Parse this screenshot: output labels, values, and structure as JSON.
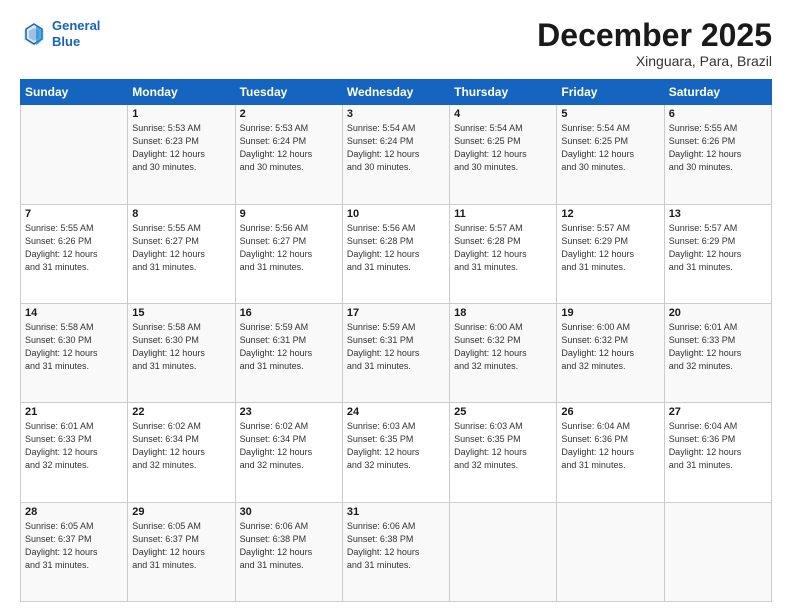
{
  "header": {
    "logo_line1": "General",
    "logo_line2": "Blue",
    "month": "December 2025",
    "location": "Xinguara, Para, Brazil"
  },
  "days_of_week": [
    "Sunday",
    "Monday",
    "Tuesday",
    "Wednesday",
    "Thursday",
    "Friday",
    "Saturday"
  ],
  "weeks": [
    [
      {
        "day": "",
        "empty": true
      },
      {
        "day": "1",
        "sunrise": "5:53 AM",
        "sunset": "6:23 PM",
        "daylight": "12 hours and 30 minutes."
      },
      {
        "day": "2",
        "sunrise": "5:53 AM",
        "sunset": "6:24 PM",
        "daylight": "12 hours and 30 minutes."
      },
      {
        "day": "3",
        "sunrise": "5:54 AM",
        "sunset": "6:24 PM",
        "daylight": "12 hours and 30 minutes."
      },
      {
        "day": "4",
        "sunrise": "5:54 AM",
        "sunset": "6:25 PM",
        "daylight": "12 hours and 30 minutes."
      },
      {
        "day": "5",
        "sunrise": "5:54 AM",
        "sunset": "6:25 PM",
        "daylight": "12 hours and 30 minutes."
      },
      {
        "day": "6",
        "sunrise": "5:55 AM",
        "sunset": "6:26 PM",
        "daylight": "12 hours and 30 minutes."
      }
    ],
    [
      {
        "day": "7",
        "sunrise": "5:55 AM",
        "sunset": "6:26 PM",
        "daylight": "12 hours and 31 minutes."
      },
      {
        "day": "8",
        "sunrise": "5:55 AM",
        "sunset": "6:27 PM",
        "daylight": "12 hours and 31 minutes."
      },
      {
        "day": "9",
        "sunrise": "5:56 AM",
        "sunset": "6:27 PM",
        "daylight": "12 hours and 31 minutes."
      },
      {
        "day": "10",
        "sunrise": "5:56 AM",
        "sunset": "6:28 PM",
        "daylight": "12 hours and 31 minutes."
      },
      {
        "day": "11",
        "sunrise": "5:57 AM",
        "sunset": "6:28 PM",
        "daylight": "12 hours and 31 minutes."
      },
      {
        "day": "12",
        "sunrise": "5:57 AM",
        "sunset": "6:29 PM",
        "daylight": "12 hours and 31 minutes."
      },
      {
        "day": "13",
        "sunrise": "5:57 AM",
        "sunset": "6:29 PM",
        "daylight": "12 hours and 31 minutes."
      }
    ],
    [
      {
        "day": "14",
        "sunrise": "5:58 AM",
        "sunset": "6:30 PM",
        "daylight": "12 hours and 31 minutes."
      },
      {
        "day": "15",
        "sunrise": "5:58 AM",
        "sunset": "6:30 PM",
        "daylight": "12 hours and 31 minutes."
      },
      {
        "day": "16",
        "sunrise": "5:59 AM",
        "sunset": "6:31 PM",
        "daylight": "12 hours and 31 minutes."
      },
      {
        "day": "17",
        "sunrise": "5:59 AM",
        "sunset": "6:31 PM",
        "daylight": "12 hours and 31 minutes."
      },
      {
        "day": "18",
        "sunrise": "6:00 AM",
        "sunset": "6:32 PM",
        "daylight": "12 hours and 32 minutes."
      },
      {
        "day": "19",
        "sunrise": "6:00 AM",
        "sunset": "6:32 PM",
        "daylight": "12 hours and 32 minutes."
      },
      {
        "day": "20",
        "sunrise": "6:01 AM",
        "sunset": "6:33 PM",
        "daylight": "12 hours and 32 minutes."
      }
    ],
    [
      {
        "day": "21",
        "sunrise": "6:01 AM",
        "sunset": "6:33 PM",
        "daylight": "12 hours and 32 minutes."
      },
      {
        "day": "22",
        "sunrise": "6:02 AM",
        "sunset": "6:34 PM",
        "daylight": "12 hours and 32 minutes."
      },
      {
        "day": "23",
        "sunrise": "6:02 AM",
        "sunset": "6:34 PM",
        "daylight": "12 hours and 32 minutes."
      },
      {
        "day": "24",
        "sunrise": "6:03 AM",
        "sunset": "6:35 PM",
        "daylight": "12 hours and 32 minutes."
      },
      {
        "day": "25",
        "sunrise": "6:03 AM",
        "sunset": "6:35 PM",
        "daylight": "12 hours and 32 minutes."
      },
      {
        "day": "26",
        "sunrise": "6:04 AM",
        "sunset": "6:36 PM",
        "daylight": "12 hours and 31 minutes."
      },
      {
        "day": "27",
        "sunrise": "6:04 AM",
        "sunset": "6:36 PM",
        "daylight": "12 hours and 31 minutes."
      }
    ],
    [
      {
        "day": "28",
        "sunrise": "6:05 AM",
        "sunset": "6:37 PM",
        "daylight": "12 hours and 31 minutes."
      },
      {
        "day": "29",
        "sunrise": "6:05 AM",
        "sunset": "6:37 PM",
        "daylight": "12 hours and 31 minutes."
      },
      {
        "day": "30",
        "sunrise": "6:06 AM",
        "sunset": "6:38 PM",
        "daylight": "12 hours and 31 minutes."
      },
      {
        "day": "31",
        "sunrise": "6:06 AM",
        "sunset": "6:38 PM",
        "daylight": "12 hours and 31 minutes."
      },
      {
        "day": "",
        "empty": true
      },
      {
        "day": "",
        "empty": true
      },
      {
        "day": "",
        "empty": true
      }
    ]
  ],
  "labels": {
    "sunrise": "Sunrise:",
    "sunset": "Sunset:",
    "daylight": "Daylight:"
  }
}
